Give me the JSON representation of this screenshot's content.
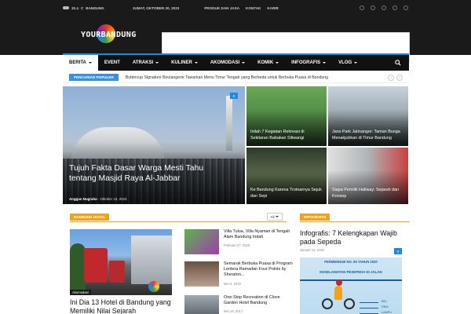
{
  "topbar": {
    "temperature": "32.4",
    "unit": "C",
    "city": "BANDUNG",
    "date": "JUMAT, OKTOBER 20, 2023",
    "links": [
      "PRODUK DAN JASA",
      "KONTAK",
      "KARIR"
    ],
    "social_icons": [
      "facebook-icon",
      "twitter-icon",
      "instagram-icon",
      "mail-icon",
      "youtube-icon"
    ]
  },
  "header": {
    "logo_text": "YOURBANDUNG"
  },
  "nav": {
    "items": [
      {
        "label": "BERITA",
        "active": true,
        "dropdown": true
      },
      {
        "label": "EVENT",
        "active": false,
        "dropdown": false
      },
      {
        "label": "ATRAKSI",
        "active": false,
        "dropdown": true
      },
      {
        "label": "KULINER",
        "active": false,
        "dropdown": true
      },
      {
        "label": "AKOMODASI",
        "active": false,
        "dropdown": true
      },
      {
        "label": "KOMIK",
        "active": false,
        "dropdown": true
      },
      {
        "label": "INFOGRAFIS",
        "active": false,
        "dropdown": true
      },
      {
        "label": "VLOG",
        "active": false,
        "dropdown": true
      }
    ]
  },
  "trending": {
    "badge": "PENCARIAN POPULER",
    "text": "Buttercup Signature Boulangerie Tawarkan Menu Timur Tengah yang Berbeda untuk Berbuka Puasa di Bandung",
    "prev": "‹",
    "next": "›"
  },
  "hero": {
    "main": {
      "title": "Tujuh Fakta Dasar Warga Mesti Tahu tentang Masjid Raya Al-Jabbar",
      "author": "Anggun Nugraha",
      "date": "Oktober 19, 2023",
      "comments": "0"
    },
    "tiles": [
      {
        "title": "Inilah 7 Kegiatan Rekreasi di Sekitaran Babakan Siliwangi"
      },
      {
        "title": "Jans Park Jatinangor: Taman Bunga Menakjubkan di Timur Bandung"
      },
      {
        "title": "Ke Bandung Karena Trotoarnya Sejuk dan Sepi"
      },
      {
        "title": "Siapa Pemilik Hallway: Sejarah dan Konsep"
      }
    ]
  },
  "section_hotel": {
    "label": "BANDUNG HOTEL",
    "filter": "All",
    "featured": {
      "category": "Akomodasi",
      "title": "Ini Dia 13 Hotel di Bandung yang Memiliki Nilai Sejarah"
    },
    "list": [
      {
        "title": "Villa Tulua, Villa Nyaman di Tengah Alam Bandung Indah",
        "date": "Februari 27, 2020"
      },
      {
        "title": "Semarak Berbuka Puasa di Program Lentera Ramadan Four Points by Sheraton...",
        "date": "Mei 3, 2019"
      },
      {
        "title": "One-Stop Recreation di Clove Garden Hotel Bandung",
        "date": "Mei 19, 2017"
      }
    ]
  },
  "section_info": {
    "label": "INFOGRAFIS",
    "title": "Infografis: 7 Kelengkapan Wajib pada Sepeda",
    "date": "Januari 12, 2022",
    "comments": "0",
    "image_heading_1": "PERMENHUB NO. 59 TAHUN 2020",
    "image_heading_2": "KESELAMATAN PESEPEDA DI JALAN",
    "image_labels": [
      "BEL",
      "REM",
      "LAMPU"
    ]
  },
  "colors": {
    "accent_blue": "#1e88e5",
    "accent_orange": "#f0a21a",
    "dark": "#1a1a1a"
  }
}
